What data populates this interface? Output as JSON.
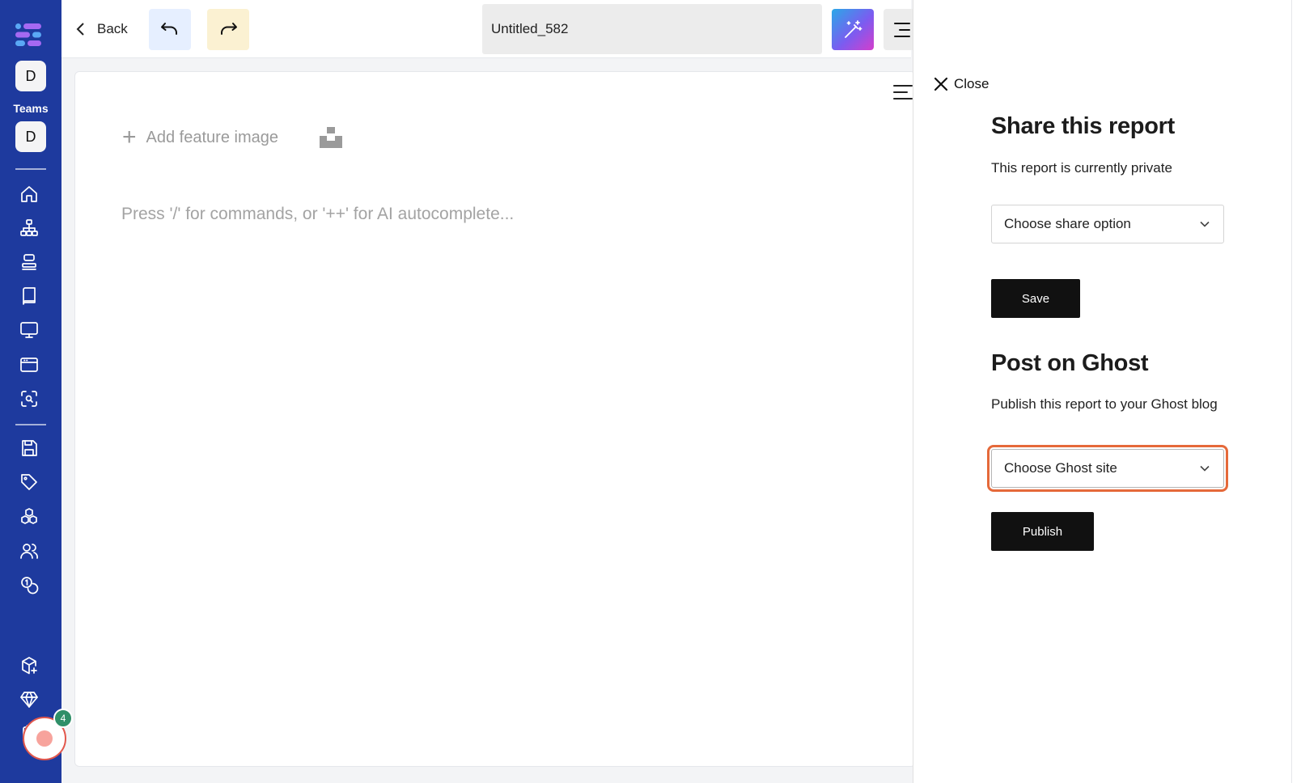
{
  "rail": {
    "team_avatar_1": "D",
    "teams_label": "Teams",
    "team_avatar_2": "D",
    "nav_icons": [
      "home-icon",
      "sitemap-icon",
      "stack-icon",
      "book-icon",
      "monitor-icon",
      "browser-window-icon",
      "scan-search-icon",
      "save-icon",
      "tag-icon",
      "cubes-icon",
      "users-icon",
      "coins-icon",
      "package-plus-icon",
      "diamond-icon",
      "clipboard-icon"
    ],
    "notification_count": "4",
    "brand_color": "#1e3a9e"
  },
  "topbar": {
    "back_label": "Back",
    "document_title": "Untitled_582"
  },
  "editor": {
    "add_feature_label": "Add feature image",
    "placeholder": "Press '/' for commands, or '++' for AI autocomplete..."
  },
  "share_panel": {
    "close_label": "Close",
    "share_heading": "Share this report",
    "share_status": "This report is currently private",
    "share_select_value": "Choose share option",
    "save_label": "Save",
    "ghost_heading": "Post on Ghost",
    "ghost_desc": "Publish this report to your Ghost blog",
    "ghost_select_value": "Choose Ghost site",
    "publish_label": "Publish",
    "focus_color": "#e5693a"
  }
}
